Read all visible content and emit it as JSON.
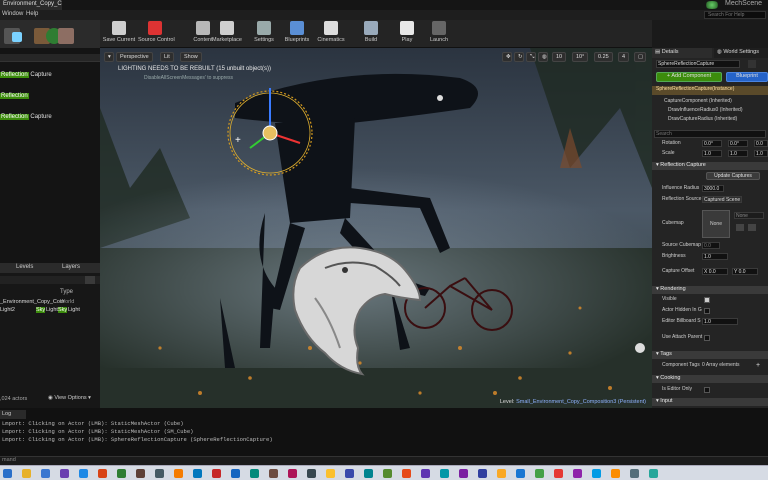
{
  "titlebar": {
    "tab": "Environment_Copy_Co",
    "brand": "MechScene",
    "search_placeholder": "Search For Help"
  },
  "menu": [
    "Window",
    "Help"
  ],
  "toolbar": {
    "items": [
      {
        "label": "Save Current",
        "icon": "save-icon",
        "color": "#cfcfcf"
      },
      {
        "label": "Source Control",
        "icon": "source-control-icon",
        "color": "#d33"
      },
      {
        "label": "Content",
        "icon": "content-icon",
        "color": "#b8b8b8"
      },
      {
        "label": "Marketplace",
        "icon": "marketplace-icon",
        "color": "#cfcfcf"
      },
      {
        "label": "Settings",
        "icon": "gear-icon",
        "color": "#9aa"
      },
      {
        "label": "Blueprints",
        "icon": "blueprint-icon",
        "color": "#5a8fd6"
      },
      {
        "label": "Cinematics",
        "icon": "clapper-icon",
        "color": "#ddd"
      },
      {
        "label": "Build",
        "icon": "build-icon",
        "color": "#9ab"
      },
      {
        "label": "Play",
        "icon": "play-icon",
        "color": "#e8e8e8"
      },
      {
        "label": "Launch",
        "icon": "launch-icon",
        "color": "#666"
      }
    ]
  },
  "left_panel": {
    "items": [
      {
        "prefix": "",
        "highlight": "Reflection",
        "suffix": " Capture"
      },
      {
        "prefix": "",
        "highlight": "Reflection",
        "suffix": ""
      },
      {
        "prefix": "",
        "highlight": "Reflection",
        "suffix": " Capture"
      }
    ]
  },
  "outliner": {
    "tabs": [
      "Levels",
      "Layers"
    ],
    "column_type": "Type",
    "row_map": "_Environment_Copy_Com",
    "row_map_type": "World",
    "row_actor_prefix": "Light2",
    "row_actor_highlight": "Sky",
    "row_actor_type": "Light",
    "actor_count": ",024 actors",
    "view_options": "View Options"
  },
  "viewport": {
    "perspective": "Perspective",
    "lit": "Lit",
    "show": "Show",
    "warning": "LIGHTING NEEDS TO BE REBUILT (15 unbuilt object(s))",
    "warning_sub": "DisableAllScreenMessages' to suppress",
    "snap_value": "10",
    "snap_angle": "10°",
    "snap_scale": "0.25",
    "cam_speed": "4",
    "level_label": "Level: ",
    "level_name": "Small_Environment_Copy_Composition3 (Persistent)"
  },
  "details": {
    "tab_details": "Details",
    "tab_world": "World Settings",
    "name_field": "SphereReflectionCapture",
    "add_component": "+ Add Component",
    "blueprint": "Blueprint",
    "instance": "SphereReflectionCapture(Instance)",
    "components": [
      "CaptureComponent (Inherited)",
      "DrawInfluenceRadius0 (Inherited)",
      "DrawCaptureRadius (Inherited)"
    ],
    "search_placeholder": "Search",
    "rotation_label": "Rotation",
    "rotation_values": [
      "0.0°",
      "0.0°",
      "0.0"
    ],
    "scale_label": "Scale",
    "scale_values": [
      "1.0",
      "1.0",
      "1.0"
    ],
    "section_reflection": "Reflection Capture",
    "update_captures": "Update Captures",
    "influence_label": "Influence Radius",
    "influence_value": "3000.0",
    "source_label": "Reflection Source",
    "source_value": "Captured Scene",
    "cubemap_label": "Cubemap",
    "cubemap_thumb": "None",
    "cubemap_none": "None",
    "source_cubemap_label": "Source Cubemap",
    "source_cubemap_value": "0.0",
    "brightness_label": "Brightness",
    "brightness_value": "1.0",
    "capture_offset_label": "Capture Offset",
    "capture_offset_x": "X 0.0",
    "capture_offset_y": "Y 0.0",
    "section_rendering": "Rendering",
    "visible_label": "Visible",
    "hidden_label": "Actor Hidden In G",
    "billboard_label": "Editor Billboard S",
    "billboard_value": "1.0",
    "attach_label": "Use Attach Parent",
    "section_tags": "Tags",
    "component_tags_label": "Component Tags",
    "component_tags_value": "0 Array elements",
    "section_cooking": "Cooking",
    "editor_only_label": "Is Editor Only",
    "section_input": "Input"
  },
  "log": {
    "tab": "Log",
    "lines": [
      "Lmport: Clicking on Actor (LMB): StaticMeshActor (Cube)",
      "Lmport: Clicking on Actor (LMB): StaticMeshActor (SM_Cube)",
      "Lmport: Clicking on Actor (LMB): SphereReflectionCapture (SphereReflectionCapture)"
    ],
    "cmd_placeholder": "mand"
  },
  "taskbar": {
    "icons": [
      "#2a6fc9",
      "#e7b12a",
      "#3b77d0",
      "#6a3fb0",
      "#1e88e5",
      "#d84315",
      "#2e7d32",
      "#5d4037",
      "#455a64",
      "#f57c00",
      "#0277bd",
      "#c62828",
      "#1565c0",
      "#00897b",
      "#6d4c41",
      "#ad1457",
      "#37474f",
      "#fbc02d",
      "#3949ab",
      "#00838f",
      "#558b2f",
      "#e64a19",
      "#5e35b1",
      "#0097a7",
      "#7b1fa2",
      "#303f9f",
      "#f9a825",
      "#1976d2",
      "#43a047",
      "#e53935",
      "#8e24aa",
      "#039be5",
      "#fb8c00",
      "#546e7a",
      "#26a69a"
    ]
  }
}
